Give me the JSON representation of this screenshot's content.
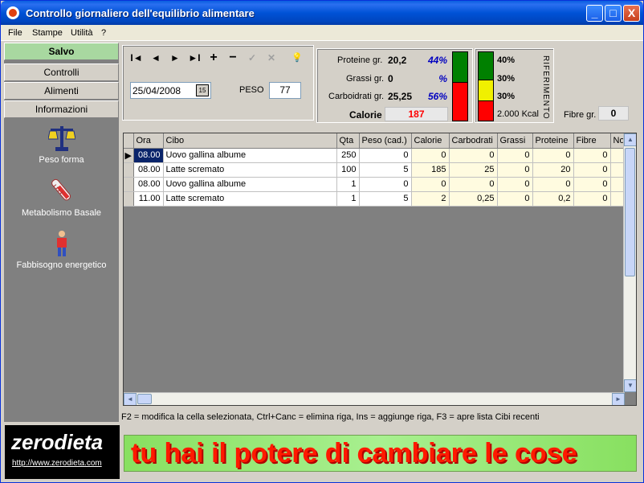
{
  "window": {
    "title": "Controllo giornaliero dell'equilibrio alimentare",
    "minimize": "_",
    "maximize": "□",
    "close": "X"
  },
  "menu": [
    "File",
    "Stampe",
    "Utilità",
    "?"
  ],
  "leftnav": {
    "buttons": [
      "Salvo",
      "Controlli",
      "Alimenti",
      "Informazioni"
    ],
    "icons": [
      {
        "label": "Peso forma",
        "icon": "scales-icon"
      },
      {
        "label": "Metabolismo Basale",
        "icon": "thermometer-icon"
      },
      {
        "label": "Fabbisogno energetico",
        "icon": "person-icon"
      }
    ]
  },
  "toolbar": {
    "first": "I◄",
    "prev": "◄",
    "next": "►",
    "last": "►I",
    "add": "+",
    "remove": "−",
    "confirm": "✓",
    "cancel": "✕",
    "hint": "💡"
  },
  "date": {
    "value": "25/04/2008",
    "button": "15"
  },
  "peso": {
    "label": "PESO",
    "value": "77"
  },
  "summary": {
    "proteine": {
      "label": "Proteine gr.",
      "value": "20,2",
      "pct": "44%"
    },
    "grassi": {
      "label": "Grassi gr.",
      "value": "0",
      "pct": "%"
    },
    "carboidrati": {
      "label": "Carboidrati gr.",
      "value": "25,25",
      "pct": "56%"
    },
    "calorie": {
      "label": "Calorie",
      "value": "187"
    }
  },
  "riferimento": {
    "title": "RIFERIMENTO",
    "rows": [
      "40%",
      "30%",
      "30%"
    ],
    "kcal": "2.000 Kcal",
    "colors": [
      "#008000",
      "#f0f000",
      "#ff0000"
    ]
  },
  "fibre": {
    "label": "Fibre gr.",
    "value": "0"
  },
  "grid": {
    "headers": [
      "Ora",
      "Cibo",
      "Qta",
      "Peso (cad.)",
      "Calorie",
      "Carbodrati",
      "Grassi",
      "Proteine",
      "Fibre",
      "No"
    ],
    "rows": [
      [
        "08.00",
        "Uovo gallina albume",
        "250",
        "0",
        "0",
        "0",
        "0",
        "0",
        "0"
      ],
      [
        "08.00",
        "Latte scremato",
        "100",
        "5",
        "185",
        "25",
        "0",
        "20",
        "0"
      ],
      [
        "08.00",
        "Uovo gallina albume",
        "1",
        "0",
        "0",
        "0",
        "0",
        "0",
        "0"
      ],
      [
        "11.00",
        "Latte scremato",
        "1",
        "5",
        "2",
        "0,25",
        "0",
        "0,2",
        "0"
      ]
    ]
  },
  "status": "F2 = modifica la cella selezionata, Ctrl+Canc = elimina riga, Ins = aggiunge riga, F3 = apre lista Cibi recenti",
  "logo": {
    "text": "zerodieta",
    "url": "http://www.zerodieta.com"
  },
  "banner": "tu hai il potere di cambiare le cose"
}
